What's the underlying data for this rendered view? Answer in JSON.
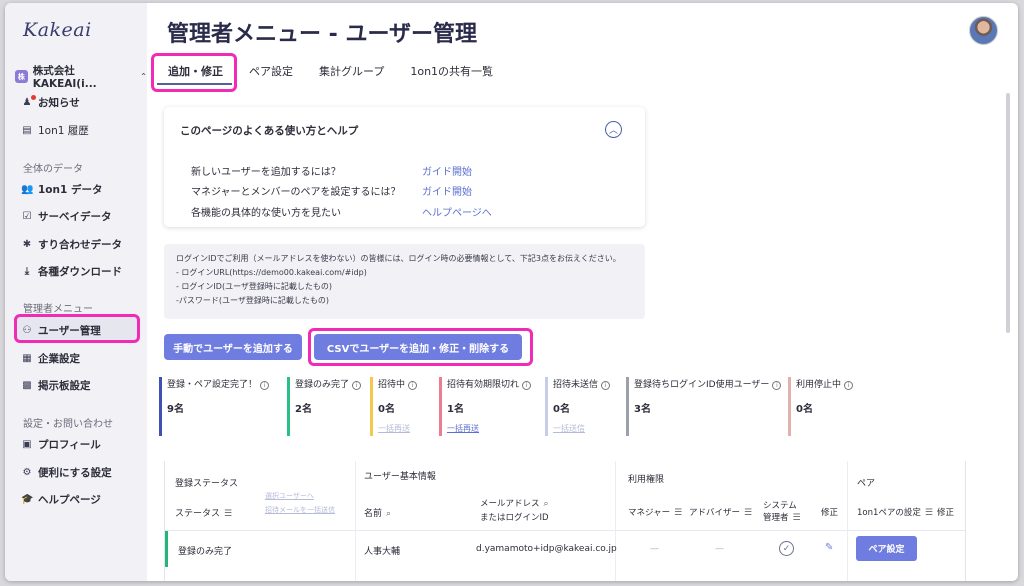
{
  "app": {
    "logo": "Kakeai",
    "page_title": "管理者メニュー - ユーザー管理"
  },
  "sidebar": {
    "company": "株式会社KAKEAI(i...",
    "company_badge": "株",
    "items_top": [
      {
        "label": "お知らせ",
        "icon": "bell-icon"
      },
      {
        "label": "1on1 履歴",
        "icon": "history-icon"
      }
    ],
    "section_data": "全体のデータ",
    "items_data": [
      {
        "label": "1on1 データ",
        "icon": "people-icon"
      },
      {
        "label": "サーベイデータ",
        "icon": "survey-icon"
      },
      {
        "label": "すり合わせデータ",
        "icon": "puzzle-icon"
      },
      {
        "label": "各種ダウンロード",
        "icon": "download-icon"
      }
    ],
    "section_admin": "管理者メニュー",
    "items_admin": [
      {
        "label": "ユーザー管理",
        "icon": "user-manage-icon"
      },
      {
        "label": "企業設定",
        "icon": "building-icon"
      },
      {
        "label": "掲示板設定",
        "icon": "board-icon"
      }
    ],
    "section_settings": "設定・お問い合わせ",
    "items_settings": [
      {
        "label": "プロフィール",
        "icon": "profile-icon"
      },
      {
        "label": "便利にする設定",
        "icon": "gear-icon"
      },
      {
        "label": "ヘルプページ",
        "icon": "graduation-icon"
      }
    ]
  },
  "tabs": [
    "追加・修正",
    "ペア設定",
    "集計グループ",
    "1on1の共有一覧"
  ],
  "help": {
    "title": "このページのよくある使い方とヘルプ",
    "rows": [
      {
        "question": "新しいユーザーを追加するには？",
        "link": "ガイド開始"
      },
      {
        "question": "マネジャーとメンバーのペアを設定するには？",
        "link": "ガイド開始"
      },
      {
        "question": "各機能の具体的な使い方を見たい",
        "link": "ヘルプページへ"
      }
    ]
  },
  "info": [
    "ログインIDでご利用（メールアドレスを使わない）の皆様には、ログイン時の必要情報として、下記3点をお伝えください。",
    "- ログインURL(https://demo00.kakeai.com/#idp)",
    "- ログインID(ユーザ登録時に記載したもの)",
    "-パスワード(ユーザ登録時に記載したもの)"
  ],
  "buttons": {
    "manual_add": "手動でユーザーを追加する",
    "csv": "CSVでユーザーを追加・修正・削除する"
  },
  "stats": [
    {
      "label": "登録・ペア設定完了！",
      "count": "9名",
      "color": "#3f51b5",
      "link": ""
    },
    {
      "label": "登録のみ完了",
      "count": "2名",
      "color": "#2bbf88",
      "link": ""
    },
    {
      "label": "招待中",
      "count": "0名",
      "color": "#f5c84c",
      "link": "一括再送",
      "link_color": "#b4bad8"
    },
    {
      "label": "招待有効期限切れ",
      "count": "1名",
      "color": "#ef7b8c",
      "link": "一括再送",
      "link_color": "#5b6fd0"
    },
    {
      "label": "招待未送信",
      "count": "0名",
      "color": "#c7cde6",
      "link": "一括送信",
      "link_color": "#b4bad8"
    },
    {
      "label": "登録待ちログインID使用ユーザー",
      "count": "3名",
      "color": "#9aa0ad",
      "link": ""
    },
    {
      "label": "利用停止中",
      "count": "0名",
      "color": "#e0b2ae",
      "link": ""
    }
  ],
  "table": {
    "group_status": "登録ステータス",
    "group_basic": "ユーザー基本情報",
    "group_perm": "利用権限",
    "group_pair": "ペア",
    "col_status": "ステータス",
    "link_invite": "選択ユーザーへ",
    "link_mail": "招待メールを一括送信",
    "col_name": "名前",
    "col_email_1": "メールアドレス",
    "col_email_2": "またはログインID",
    "col_manager": "マネジャー",
    "col_advisor": "アドバイザー",
    "col_sysadmin_1": "システム",
    "col_sysadmin_2": "管理者",
    "col_edit": "修正",
    "col_pair": "1on1ペアの設定",
    "col_pair_edit": "修正",
    "row": {
      "status": "登録のみ完了",
      "name": "人事大輔",
      "email": "d.yamamoto+idp@kakeai.co.jp",
      "manager": "—",
      "advisor": "—",
      "pair_button": "ペア設定"
    }
  }
}
